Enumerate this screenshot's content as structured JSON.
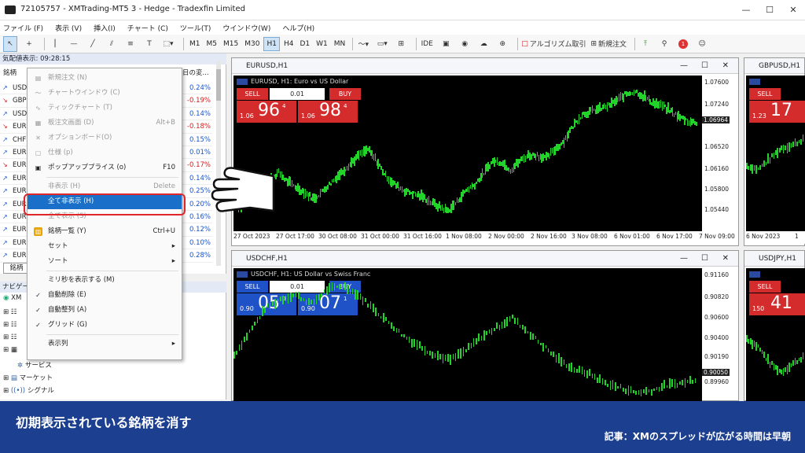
{
  "window": {
    "title": "72105757 - XMTrading-MT5 3 - Hedge - Tradexfin Limited"
  },
  "menubar": [
    "ファイル (F)",
    "表示 (V)",
    "挿入(I)",
    "チャート (C)",
    "ツール(T)",
    "ウインドウ(W)",
    "ヘルプ(H)"
  ],
  "toolbar": {
    "timeframes": [
      "M1",
      "M5",
      "M15",
      "M30",
      "H1",
      "H4",
      "D1",
      "W1",
      "MN"
    ],
    "active_timeframe": "H1",
    "ide": "IDE",
    "algo": "アルゴリズム取引",
    "new_order": "新規注文"
  },
  "market_watch": {
    "header": "気配値表示: 09:28:15",
    "col_symbol": "銘柄",
    "col_change": "日の変...",
    "tab": "銘柄",
    "rows": [
      {
        "sym": "USD",
        "chg": "0.24%",
        "dir": "up"
      },
      {
        "sym": "GBP",
        "chg": "-0.19%",
        "dir": "dn"
      },
      {
        "sym": "USD",
        "chg": "0.14%",
        "dir": "up"
      },
      {
        "sym": "EUR",
        "chg": "-0.18%",
        "dir": "dn"
      },
      {
        "sym": "CHF",
        "chg": "0.15%",
        "dir": "up"
      },
      {
        "sym": "EUR",
        "chg": "0.01%",
        "dir": "up"
      },
      {
        "sym": "EUR",
        "chg": "-0.17%",
        "dir": "dn"
      },
      {
        "sym": "EUR",
        "chg": "0.14%",
        "dir": "up"
      },
      {
        "sym": "EUR",
        "chg": "0.25%",
        "dir": "up"
      },
      {
        "sym": "EUR",
        "chg": "0.20%",
        "dir": "up"
      },
      {
        "sym": "EUR",
        "chg": "0.16%",
        "dir": "up"
      },
      {
        "sym": "EUR",
        "chg": "0.12%",
        "dir": "up"
      },
      {
        "sym": "EUR",
        "chg": "0.10%",
        "dir": "up"
      },
      {
        "sym": "EUR",
        "chg": "0.28%",
        "dir": "up"
      }
    ]
  },
  "navigator": {
    "header": "ナビゲー",
    "items": [
      "XM",
      "サービス",
      "マーケット",
      "シグナル"
    ]
  },
  "context_menu": {
    "items": [
      {
        "label": "新規注文 (N)",
        "shortcut": "",
        "state": "disabled"
      },
      {
        "label": "チャートウインドウ (C)",
        "shortcut": "",
        "state": "disabled"
      },
      {
        "label": "ティックチャート (T)",
        "shortcut": "",
        "state": "disabled"
      },
      {
        "label": "板注文画面 (D)",
        "shortcut": "Alt+B",
        "state": "disabled"
      },
      {
        "label": "オプションボード(O)",
        "shortcut": "",
        "state": "disabled"
      },
      {
        "label": "仕様 (p)",
        "shortcut": "",
        "state": "disabled"
      },
      {
        "label": "ポップアッププライス (o)",
        "shortcut": "F10",
        "state": "normal"
      },
      {
        "label": "非表示 (H)",
        "shortcut": "Delete",
        "state": "disabled"
      },
      {
        "label": "全て非表示 (H)",
        "shortcut": "",
        "state": "highlighted"
      },
      {
        "label": "全て表示 (S)",
        "shortcut": "",
        "state": "disabled"
      },
      {
        "label": "銘柄一覧 (Y)",
        "shortcut": "Ctrl+U",
        "state": "normal"
      },
      {
        "label": "セット",
        "shortcut": "",
        "state": "submenu"
      },
      {
        "label": "ソート",
        "shortcut": "",
        "state": "submenu"
      },
      {
        "label": "ミリ秒を表示する (M)",
        "shortcut": "",
        "state": "normal"
      },
      {
        "label": "自動削除 (E)",
        "shortcut": "",
        "state": "checked"
      },
      {
        "label": "自動整列 (A)",
        "shortcut": "",
        "state": "checked"
      },
      {
        "label": "グリッド (G)",
        "shortcut": "",
        "state": "checked"
      },
      {
        "label": "表示列",
        "shortcut": "",
        "state": "submenu"
      }
    ]
  },
  "charts": {
    "eurusd": {
      "title": "EURUSD,H1",
      "caption": "EURUSD, H1: Euro vs US Dollar",
      "sell": "SELL",
      "buy": "BUY",
      "lot": "0.01",
      "bid_prefix": "1.06",
      "bid_big": "96",
      "bid_sup": "4",
      "ask_prefix": "1.06",
      "ask_big": "98",
      "ask_sup": "4",
      "prices": [
        "1.07600",
        "1.07240",
        "1.06964",
        "1.06520",
        "1.06160",
        "1.05800",
        "1.05440"
      ],
      "times": [
        "27 Oct 2023",
        "27 Oct 17:00",
        "30 Oct 08:00",
        "31 Oct 00:00",
        "31 Oct 16:00",
        "1 Nov 08:00",
        "2 Nov 00:00",
        "2 Nov 16:00",
        "3 Nov 08:00",
        "6 Nov 01:00",
        "6 Nov 17:00",
        "7 Nov 09:00"
      ],
      "line": [
        1.0556,
        1.055,
        1.0575,
        1.059,
        1.06,
        1.061,
        1.0595,
        1.0585,
        1.0575,
        1.0565,
        1.058,
        1.0595,
        1.061,
        1.0625,
        1.064,
        1.065,
        1.063,
        1.0605,
        1.059,
        1.058,
        1.0575,
        1.057,
        1.056,
        1.0552,
        1.0545,
        1.056,
        1.058,
        1.059,
        1.061,
        1.063,
        1.0628,
        1.0615,
        1.063,
        1.064,
        1.064,
        1.0635,
        1.065,
        1.0665,
        1.069,
        1.071,
        1.0715,
        1.072,
        1.0725,
        1.0735,
        1.0745,
        1.075,
        1.074,
        1.073,
        1.0725,
        1.0715,
        1.0705,
        1.0698,
        1.0696
      ],
      "ymin": 1.0526,
      "ymax": 1.0766
    },
    "gbpusd": {
      "title": "GBPUSD,H1",
      "sell": "SELL",
      "bid_prefix": "1.23",
      "bid_big": "17",
      "times": [
        "6 Nov 2023",
        "1"
      ]
    },
    "usdchf": {
      "title": "USDCHF,H1",
      "caption": "USDCHF, H1: US Dollar vs Swiss Franc",
      "sell": "SELL",
      "buy": "BUY",
      "lot": "0.01",
      "bid_prefix": "0.90",
      "bid_big": "05",
      "bid_sup": "0",
      "ask_prefix": "0.90",
      "ask_big": "07",
      "ask_sup": "1",
      "prices": [
        "0.91160",
        "0.90820",
        "0.90600",
        "0.90400",
        "0.90190",
        "0.90050",
        "0.89960"
      ],
      "line": [
        0.903,
        0.9055,
        0.908,
        0.909,
        0.9095,
        0.9085,
        0.91,
        0.9105,
        0.9095,
        0.908,
        0.9065,
        0.905,
        0.904,
        0.903,
        0.9025,
        0.9035,
        0.905,
        0.906,
        0.907,
        0.9055,
        0.904,
        0.9025,
        0.9015,
        0.901,
        0.9,
        0.8995,
        0.899,
        0.8992,
        0.8998,
        0.9,
        0.9005
      ],
      "ymin": 0.8985,
      "ymax": 0.912
    },
    "usdjpy": {
      "title": "USDJPY,H1",
      "sell": "SELL",
      "bid_prefix": "150",
      "bid_big": "41"
    }
  },
  "banner": {
    "title": "初期表示されている銘柄を消す",
    "subtitle": "記事：XMのスプレッドが広がる時間は早朝"
  }
}
